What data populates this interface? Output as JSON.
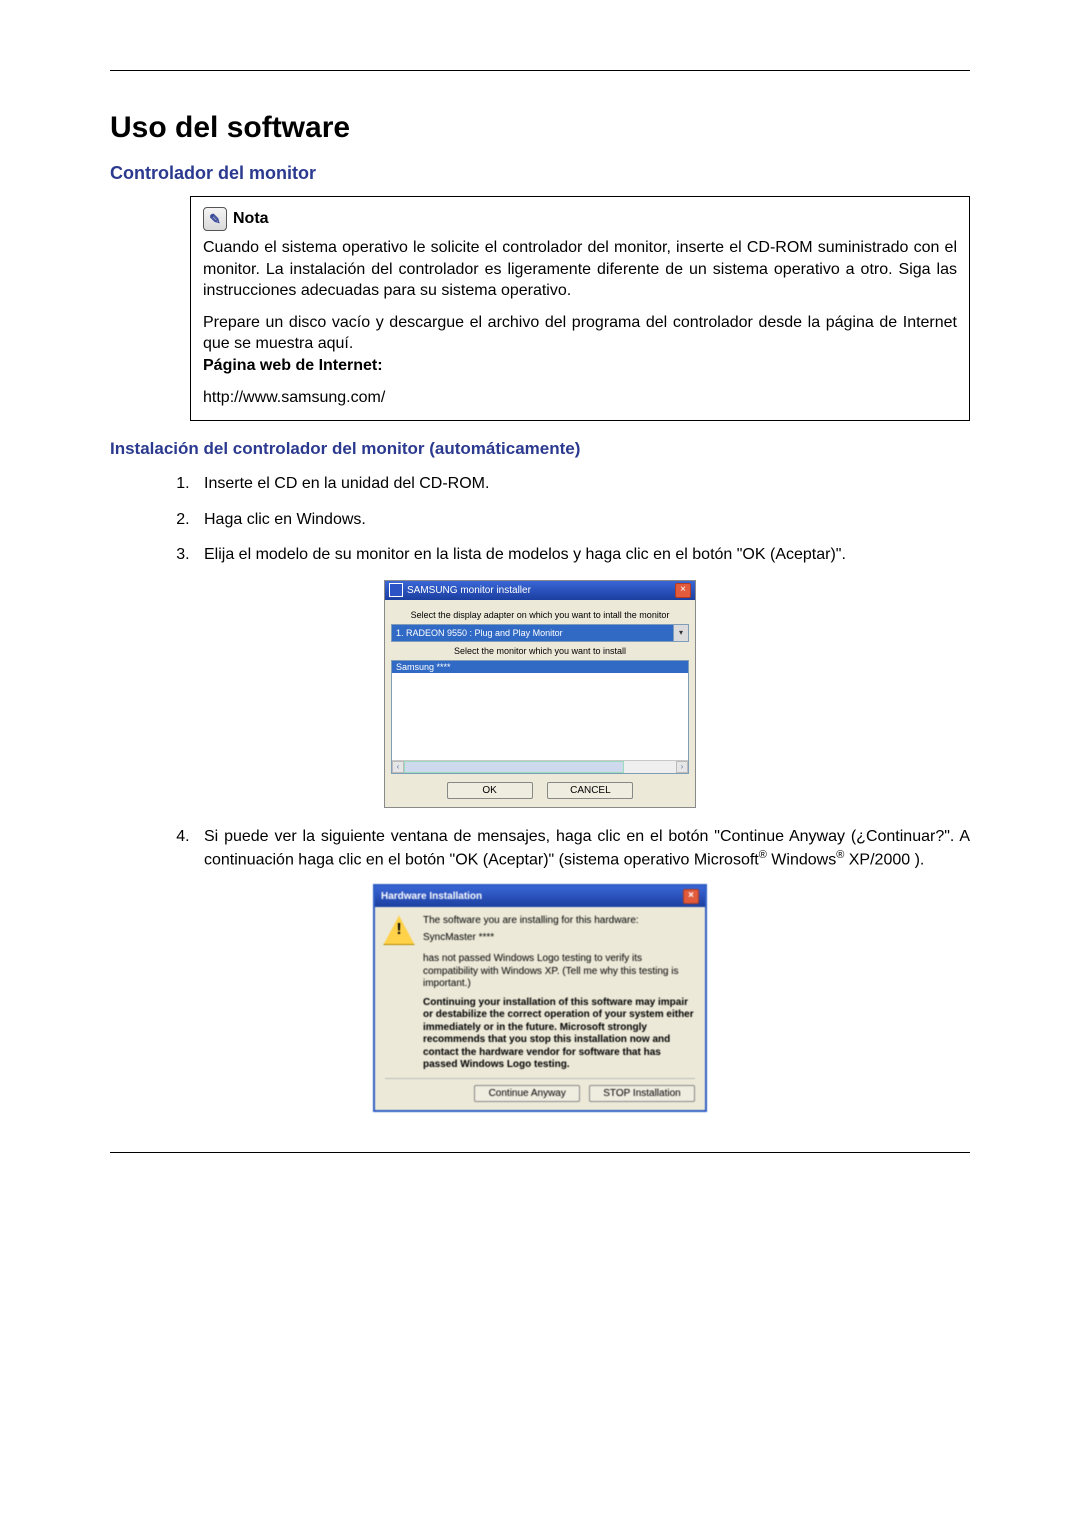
{
  "title": "Uso del software",
  "section": "Controlador del monitor",
  "note": {
    "label": "Nota",
    "p1": "Cuando el sistema operativo le solicite el controlador del monitor, inserte el CD-ROM suministrado con el monitor. La instalación del controlador es ligeramente diferente de un sistema operativo a otro. Siga las instrucciones adecuadas para su sistema operativo.",
    "p2": "Prepare un disco vacío y descargue el archivo del programa del controlador desde la página de Internet que se muestra aquí.",
    "label2": "Página web de Internet:",
    "url": "http://www.samsung.com/"
  },
  "subheading": "Instalación del controlador del monitor (automáticamente)",
  "steps": {
    "s1": "Inserte el CD en la unidad del CD-ROM.",
    "s2": "Haga clic en Windows.",
    "s3": "Elija el modelo de su monitor en la lista de modelos y haga clic en el botón \"OK (Aceptar)\".",
    "s4a": "Si puede ver la siguiente ventana de mensajes, haga clic en el botón \"Continue Anyway (¿Continuar?\". A continuación haga clic en el botón \"OK (Aceptar)\" (sistema operativo Microsoft",
    "s4b": " Windows",
    "s4c": " XP/2000 )."
  },
  "installer": {
    "title": "SAMSUNG monitor installer",
    "line1": "Select the display adapter on which you want to intall the monitor",
    "combo": "1. RADEON 9550 : Plug and Play Monitor",
    "line2": "Select the monitor which you want to install",
    "listsel": "Samsung ****",
    "ok": "OK",
    "cancel": "CANCEL"
  },
  "warn": {
    "title": "Hardware Installation",
    "line1": "The software you are installing for this hardware:",
    "device": "SyncMaster ****",
    "para1": "has not passed Windows Logo testing to verify its compatibility with Windows XP. (Tell me why this testing is important.)",
    "para2": "Continuing your installation of this software may impair or destabilize the correct operation of your system either immediately or in the future. Microsoft strongly recommends that you stop this installation now and contact the hardware vendor for software that has passed Windows Logo testing.",
    "btn_continue": "Continue Anyway",
    "btn_stop": "STOP Installation"
  }
}
